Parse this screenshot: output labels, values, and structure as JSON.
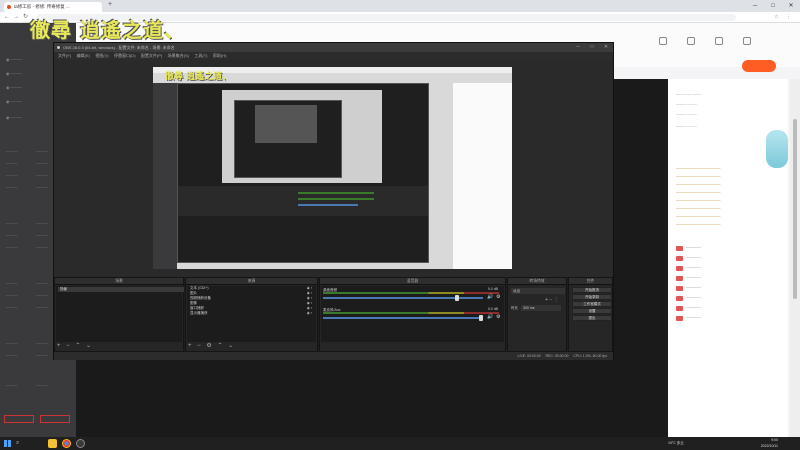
{
  "browser": {
    "tab_title": "ta修工房 - 修修: 传奇修复 ...",
    "new_tab": "+",
    "url": "",
    "min": "─",
    "max": "□",
    "close": "✕"
  },
  "overlay_text": "徹尋 逍遙之道、",
  "obs": {
    "title": "OBS 28.0.3 (64-bit, windows) - 配置文件: 未命名 - 场景: 未命名",
    "menu": [
      "文件(F)",
      "编辑(E)",
      "视图(V)",
      "停靠窗口(D)",
      "配置文件(P)",
      "场景集合(S)",
      "工具(T)",
      "帮助(H)"
    ],
    "canvas_text": "徹尋 逍遙之道、",
    "docks": {
      "scenes": "场景",
      "sources": "来源",
      "mixer": "混音器",
      "transitions": "转场特效",
      "controls": "控件"
    },
    "scene_item": "场景",
    "sources": [
      "文本 (GDI+)",
      "图片",
      "视频捕获设备",
      "图像",
      "窗口捕获",
      "显示器捕获"
    ],
    "mixer": [
      {
        "name": "桌面音频",
        "db": "0.0 dB"
      },
      {
        "name": "麦克风/Aux",
        "db": "0.0 dB"
      }
    ],
    "transition": {
      "type": "淡出",
      "duration_label": "时长",
      "duration": "300 ms"
    },
    "controls": [
      "开始推流",
      "开始录制",
      "工作室模式",
      "设置",
      "退出"
    ],
    "status": "LIVE: 00:00:00     REC: 00:00:00     CPU: 1.3%, 60.00 fps"
  },
  "taskbar": {
    "search": "⌕",
    "weather": "19°C 多云",
    "time": "9:00",
    "date": "2022/10/11"
  }
}
